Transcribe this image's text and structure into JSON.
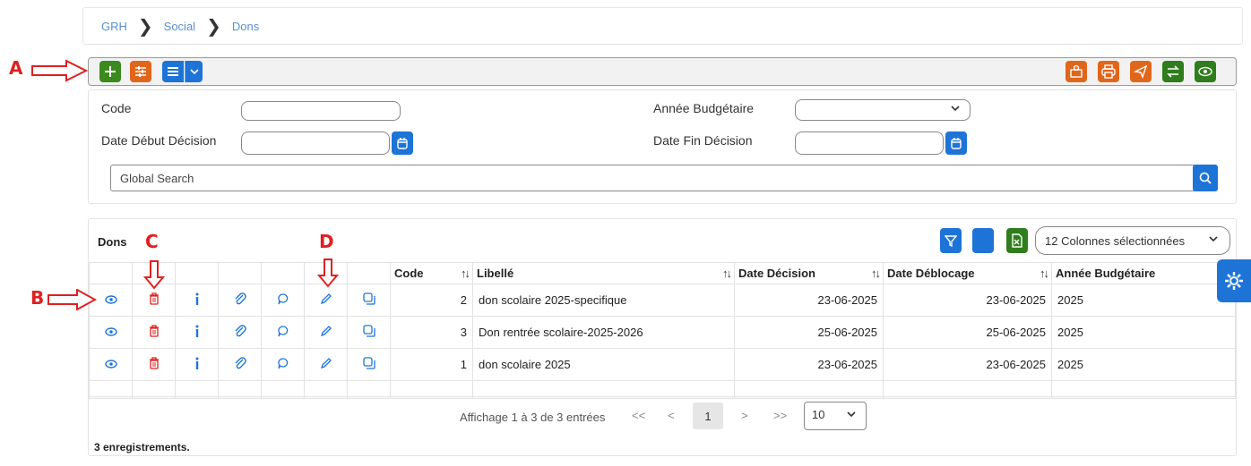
{
  "breadcrumb": {
    "items": [
      "GRH",
      "Social",
      "Dons"
    ]
  },
  "annotations": {
    "a": "A",
    "b": "B",
    "c": "C",
    "d": "D"
  },
  "colors": {
    "primary": "#1e74d6",
    "add": "#3b8a1e",
    "action": "#e0661b",
    "delete": "#e02020",
    "annotation": "#e02020"
  },
  "toolbar": {
    "left_icons": [
      "plus-icon",
      "sliders-icon",
      "list-icon",
      "chevron-down-icon"
    ],
    "right_icons": [
      "archive-user-icon",
      "print-icon",
      "send-icon",
      "exchange-icon",
      "eye-icon"
    ]
  },
  "filters": {
    "code_label": "Code",
    "code_value": "",
    "year_label": "Année Budgétaire",
    "year_value": "",
    "date_start_label": "Date Début Décision",
    "date_start_value": "",
    "date_end_label": "Date Fin Décision",
    "date_end_value": "",
    "global_search_placeholder": "Global Search"
  },
  "table": {
    "title": "Dons",
    "columns_selector": "12 Colonnes sélectionnées",
    "headers": {
      "code": "Code",
      "libelle": "Libellé",
      "date_decision": "Date Décision",
      "date_deblocage": "Date Déblocage",
      "annee": "Année Budgétaire"
    },
    "row_icons": [
      "eye-icon",
      "trash-icon",
      "info-icon",
      "paperclip-icon",
      "comment-icon",
      "pencil-icon",
      "copy-icon"
    ],
    "rows": [
      {
        "code": "2",
        "libelle": "don scolaire 2025-specifique",
        "date_decision": "23-06-2025",
        "date_deblocage": "23-06-2025",
        "annee": "2025"
      },
      {
        "code": "3",
        "libelle": "Don rentrée scolaire-2025-2026",
        "date_decision": "25-06-2025",
        "date_deblocage": "25-06-2025",
        "annee": "2025"
      },
      {
        "code": "1",
        "libelle": "don scolaire 2025",
        "date_decision": "23-06-2025",
        "date_deblocage": "23-06-2025",
        "annee": "2025"
      }
    ],
    "pagination": {
      "summary": "Affichage 1 à 3 de 3 entrées",
      "first": "<<",
      "prev": "<",
      "current": "1",
      "next": ">",
      "last": ">>",
      "page_size": "10"
    },
    "records": "3 enregistrements."
  }
}
